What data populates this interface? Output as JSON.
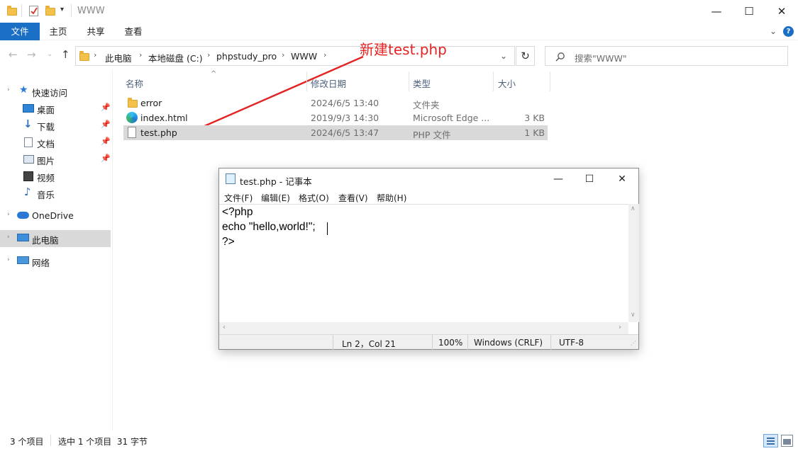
{
  "explorer": {
    "window_title": "WWW",
    "ribbon_tabs": [
      "文件",
      "主页",
      "共享",
      "查看"
    ],
    "breadcrumb": [
      "此电脑",
      "本地磁盘 (C:)",
      "phpstudy_pro",
      "WWW"
    ],
    "search_placeholder": "搜索\"WWW\"",
    "sidebar": [
      {
        "label": "快速访问",
        "icon": "star-icon"
      },
      {
        "label": "桌面",
        "icon": "desktop-icon",
        "pinned": true
      },
      {
        "label": "下载",
        "icon": "download-icon",
        "pinned": true
      },
      {
        "label": "文档",
        "icon": "document-icon",
        "pinned": true
      },
      {
        "label": "图片",
        "icon": "picture-icon",
        "pinned": true
      },
      {
        "label": "视频",
        "icon": "video-icon"
      },
      {
        "label": "音乐",
        "icon": "music-icon"
      },
      {
        "label": "OneDrive",
        "icon": "cloud-icon"
      },
      {
        "label": "此电脑",
        "icon": "computer-icon",
        "selected": true
      },
      {
        "label": "网络",
        "icon": "network-icon"
      }
    ],
    "columns": [
      "名称",
      "修改日期",
      "类型",
      "大小"
    ],
    "files": [
      {
        "name": "error",
        "date": "2024/6/5 13:40",
        "type": "文件夹",
        "size": "",
        "icon": "folder-icon"
      },
      {
        "name": "index.html",
        "date": "2019/9/3 14:30",
        "type": "Microsoft Edge ...",
        "size": "3 KB",
        "icon": "edge-icon"
      },
      {
        "name": "test.php",
        "date": "2024/6/5 13:47",
        "type": "PHP 文件",
        "size": "1 KB",
        "icon": "file-icon",
        "selected": true
      }
    ],
    "status": {
      "items_count": "3 个项目",
      "selection": "选中 1 个项目  31 字节"
    }
  },
  "annotation": {
    "text": "新建test.php",
    "color": "#e32424"
  },
  "notepad": {
    "title": "test.php - 记事本",
    "menu": [
      "文件(F)",
      "编辑(E)",
      "格式(O)",
      "查看(V)",
      "帮助(H)"
    ],
    "content_lines": [
      "<?php",
      "echo \"hello,world!\";",
      "?>"
    ],
    "status": {
      "position": "Ln 2，Col 21",
      "zoom": "100%",
      "line_ending": "Windows (CRLF)",
      "encoding": "UTF-8"
    }
  },
  "colors": {
    "accent": "#1a6fc4",
    "selection": "#d9d9d9",
    "folder": "#f4c24c"
  }
}
